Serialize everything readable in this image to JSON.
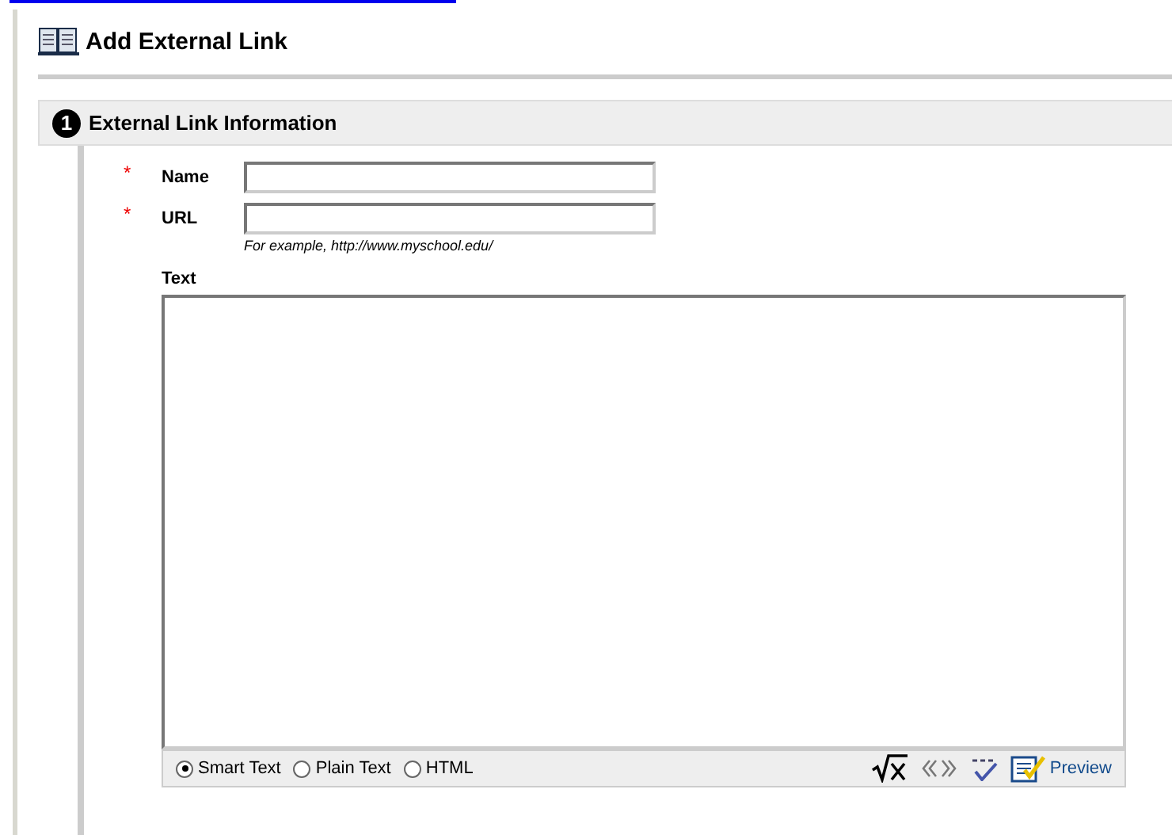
{
  "page_title": "Add External Link",
  "section": {
    "number": "1",
    "title": "External Link Information"
  },
  "fields": [
    {
      "marker": "*",
      "label": "Name"
    },
    {
      "marker": "*",
      "label": "URL",
      "hint": "For example, http://www.myschool.edu/"
    }
  ],
  "text_label": "Text",
  "format_options": [
    {
      "label": "Smart Text",
      "selected": true
    },
    {
      "label": "Plain Text",
      "selected": false
    },
    {
      "label": "HTML",
      "selected": false
    }
  ],
  "preview_label": "Preview"
}
